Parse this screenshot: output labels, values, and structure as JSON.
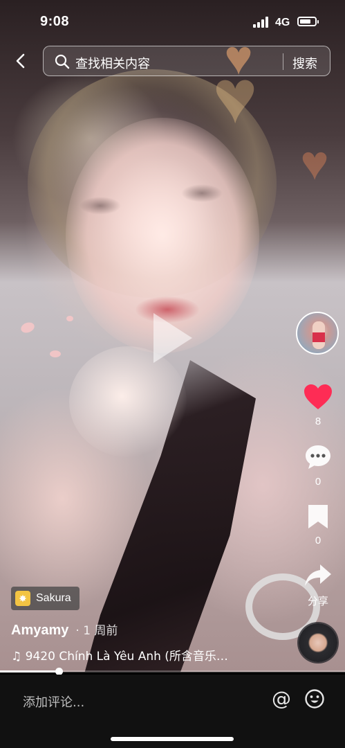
{
  "status_bar": {
    "time": "9:08",
    "network": "4G",
    "battery_level": 0.75
  },
  "search": {
    "back_icon": "chevron-left-icon",
    "placeholder": "查找相关内容",
    "button_label": "搜索"
  },
  "video": {
    "play_icon": "play-icon",
    "decor": [
      "heart-icon",
      "heart-icon",
      "petal",
      "petal"
    ]
  },
  "rail": {
    "avatar": "avatar",
    "like_count": "8",
    "comment_count": "0",
    "favorite_count": "0",
    "share_label": "分享",
    "like_color": "#fe2c55"
  },
  "info": {
    "tag_label": "Sakura",
    "author": "Amyamy",
    "posted": "· 1 周前",
    "music": "9420 Chính Là Yêu Anh (所含音乐…"
  },
  "progress": {
    "fraction": 0.17
  },
  "comment_bar": {
    "placeholder": "添加评论...",
    "at_label": "@",
    "emoji_icon": "smiley-icon"
  }
}
